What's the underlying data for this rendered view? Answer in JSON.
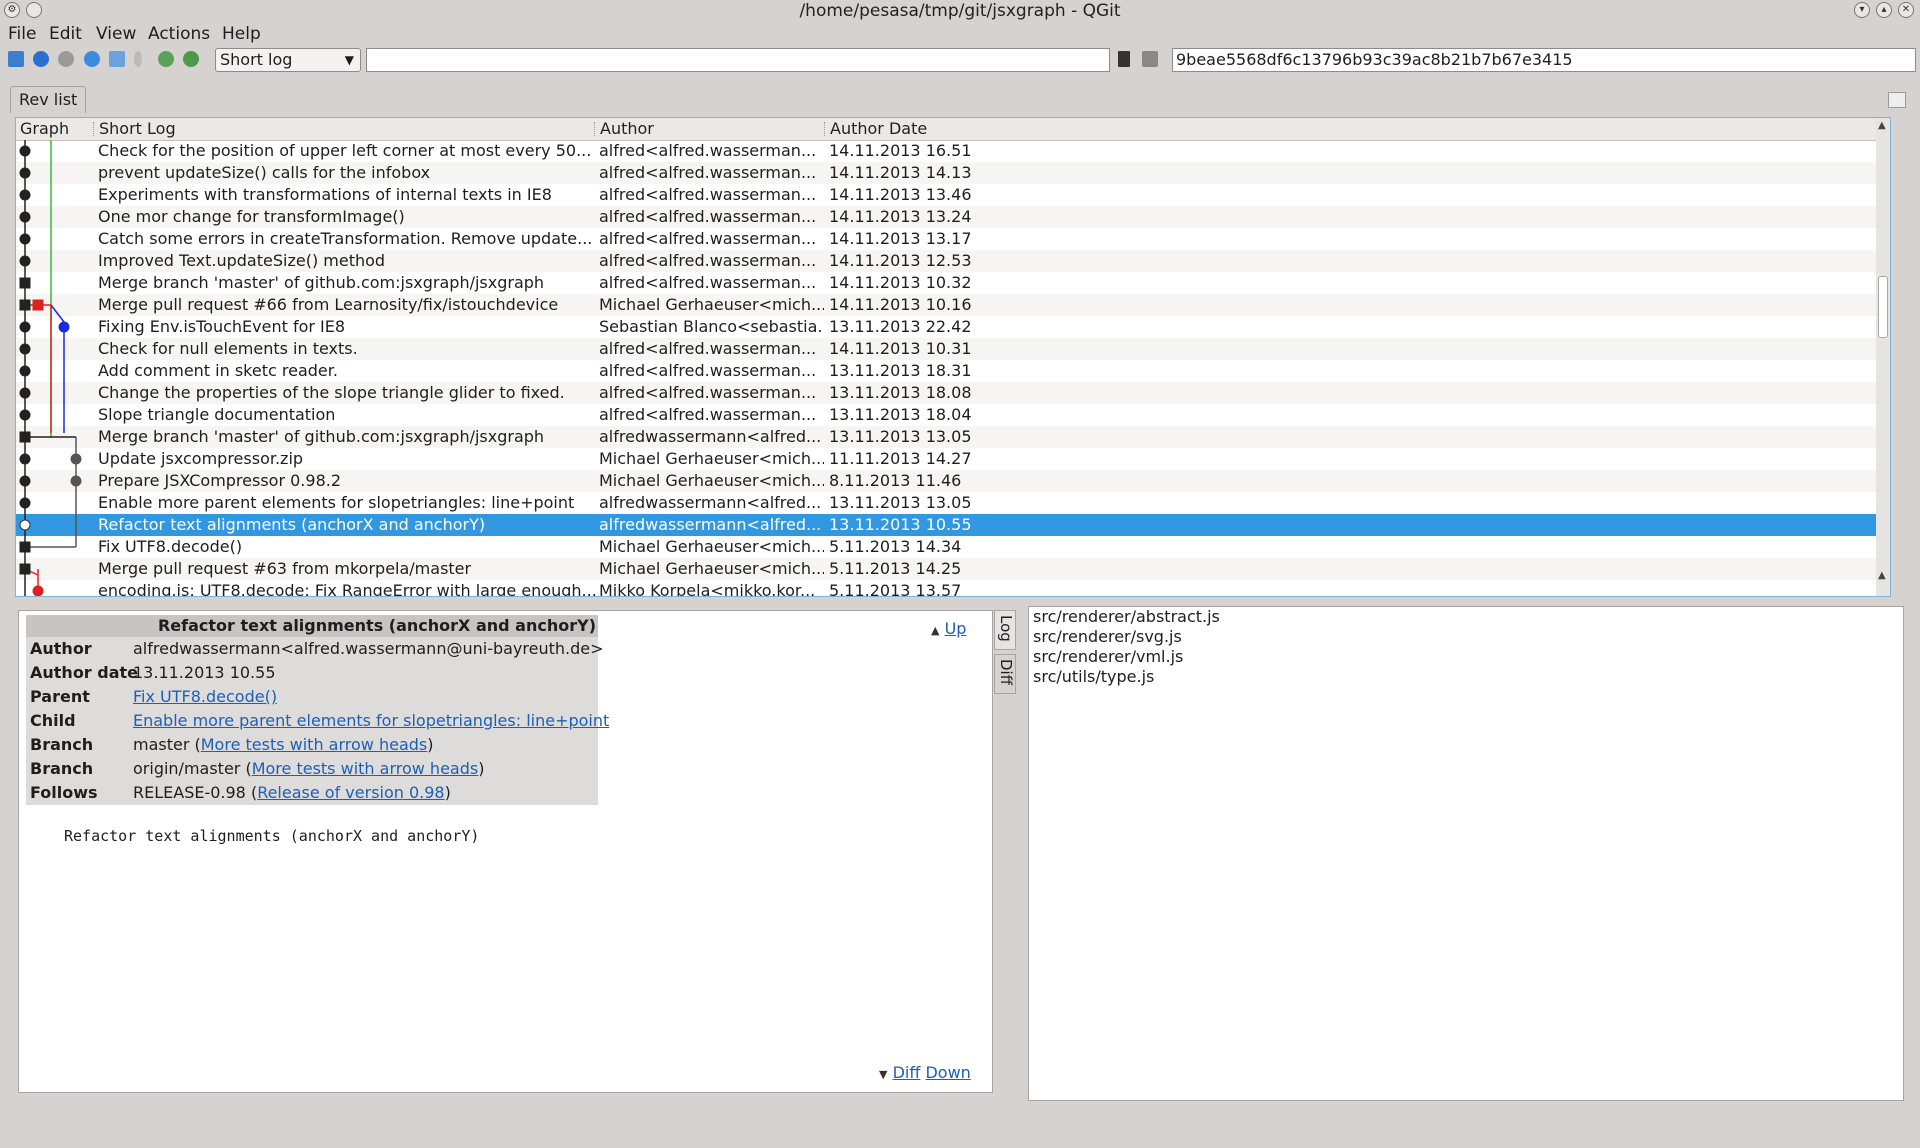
{
  "window": {
    "title": "/home/pesasa/tmp/git/jsxgraph - QGit"
  },
  "menu": [
    "File",
    "Edit",
    "View",
    "Actions",
    "Help"
  ],
  "toolbar": {
    "view_mode": "Short log",
    "filter_value": "",
    "sha": "9beae5568df6c13796b93c39ac8b21b7b67e3415"
  },
  "tab": {
    "label": "Rev list"
  },
  "columns": {
    "graph": "Graph",
    "log": "Short Log",
    "author": "Author",
    "date": "Author Date"
  },
  "commits": [
    {
      "log": "Check for the position of upper left corner at most every 50...",
      "author": "alfred<alfred.wasserman...",
      "date": "14.11.2013 16.51"
    },
    {
      "log": "prevent updateSize() calls for the infobox",
      "author": "alfred<alfred.wasserman...",
      "date": "14.11.2013 14.13"
    },
    {
      "log": "Experiments with transformations of internal texts in IE8",
      "author": "alfred<alfred.wasserman...",
      "date": "14.11.2013 13.46"
    },
    {
      "log": "One mor change for transformImage()",
      "author": "alfred<alfred.wasserman...",
      "date": "14.11.2013 13.24"
    },
    {
      "log": "Catch some errors in createTransformation. Remove update...",
      "author": "alfred<alfred.wasserman...",
      "date": "14.11.2013 13.17"
    },
    {
      "log": "Improved Text.updateSize() method",
      "author": "alfred<alfred.wasserman...",
      "date": "14.11.2013 12.53"
    },
    {
      "log": "Merge branch 'master' of github.com:jsxgraph/jsxgraph",
      "author": "alfred<alfred.wasserman...",
      "date": "14.11.2013 10.32"
    },
    {
      "log": "Merge pull request #66 from Learnosity/fix/istouchdevice",
      "author": "Michael Gerhaeuser<mich...",
      "date": "14.11.2013 10.16"
    },
    {
      "log": "Fixing Env.isTouchEvent for IE8",
      "author": "Sebastian Blanco<sebastia...",
      "date": "13.11.2013 22.42"
    },
    {
      "log": "Check for null elements in texts.",
      "author": "alfred<alfred.wasserman...",
      "date": "14.11.2013 10.31"
    },
    {
      "log": "Add comment in sketc reader.",
      "author": "alfred<alfred.wasserman...",
      "date": "13.11.2013 18.31"
    },
    {
      "log": "Change the properties of the slope triangle glider to fixed.",
      "author": "alfred<alfred.wasserman...",
      "date": "13.11.2013 18.08"
    },
    {
      "log": "Slope triangle documentation",
      "author": "alfred<alfred.wasserman...",
      "date": "13.11.2013 18.04"
    },
    {
      "log": "Merge branch 'master' of github.com:jsxgraph/jsxgraph",
      "author": "alfredwassermann<alfred...",
      "date": "13.11.2013 13.05"
    },
    {
      "log": "Update jsxcompressor.zip",
      "author": "Michael Gerhaeuser<mich...",
      "date": "11.11.2013 14.27"
    },
    {
      "log": "Prepare JSXCompressor 0.98.2",
      "author": "Michael Gerhaeuser<mich...",
      "date": "8.11.2013 11.46"
    },
    {
      "log": "Enable more parent elements for slopetriangles: line+point",
      "author": "alfredwassermann<alfred...",
      "date": "13.11.2013 13.05"
    },
    {
      "log": "Refactor text alignments (anchorX and anchorY)",
      "author": "alfredwassermann<alfred...",
      "date": "13.11.2013 10.55"
    },
    {
      "log": "Fix UTF8.decode()",
      "author": "Michael Gerhaeuser<mich...",
      "date": "5.11.2013 14.34"
    },
    {
      "log": "Merge pull request #63 from mkorpela/master",
      "author": "Michael Gerhaeuser<mich...",
      "date": "5.11.2013 14.25"
    },
    {
      "log": "encoding.js: UTF8.decode: Fix RangeError with large enough...",
      "author": "Mikko Korpela<mikko.kor...",
      "date": "5.11.2013 13.57"
    }
  ],
  "selected_index": 17,
  "details": {
    "heading": "Refactor text alignments (anchorX and anchorY)",
    "author_label": "Author",
    "author": "alfredwassermann<alfred.wassermann@uni-bayreuth.de>",
    "date_label": "Author date",
    "date": "13.11.2013 10.55",
    "parent_label": "Parent",
    "parent": "Fix UTF8.decode()",
    "child_label": "Child",
    "child": "Enable more parent elements for slopetriangles: line+point",
    "branch_label": "Branch",
    "branch1_name": "master",
    "branch1_link": "More tests with arrow heads",
    "branch2_name": "origin/master",
    "branch2_link": "More tests with arrow heads",
    "follows_label": "Follows",
    "follows_name": "RELEASE-0.98",
    "follows_link": "Release of version 0.98",
    "message": "Refactor text alignments (anchorX and anchorY)",
    "up_label": "Up",
    "diff_label": "Diff",
    "down_label": "Down"
  },
  "side_tabs": {
    "log": "Log",
    "diff": "Diff"
  },
  "files": [
    "src/renderer/abstract.js",
    "src/renderer/svg.js",
    "src/renderer/vml.js",
    "src/utils/type.js"
  ],
  "colors": {
    "selection": "#3097e0",
    "branch_green": "#2fbf2f",
    "branch_red": "#e02020",
    "branch_blue": "#1a2ae0",
    "link": "#1d5fb8"
  }
}
